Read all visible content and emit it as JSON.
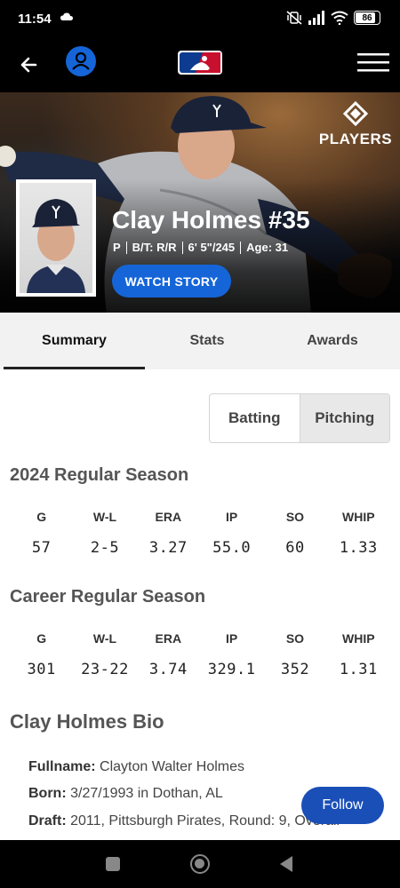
{
  "status_bar": {
    "time": "11:54",
    "battery": "86",
    "battery_level": 0.86
  },
  "hero": {
    "brand": "PLAYERS",
    "player_name": "Clay Holmes #35",
    "meta": [
      "P",
      "B/T: R/R",
      "6' 5\"/245",
      "Age: 31"
    ],
    "watch_label": "WATCH STORY"
  },
  "tabs": [
    "Summary",
    "Stats",
    "Awards"
  ],
  "toggle": {
    "batting": "Batting",
    "pitching": "Pitching"
  },
  "season": {
    "title": "2024 Regular Season",
    "headers": [
      "G",
      "W-L",
      "ERA",
      "IP",
      "SO",
      "WHIP"
    ],
    "values": [
      "57",
      "2-5",
      "3.27",
      "55.0",
      "60",
      "1.33"
    ]
  },
  "career": {
    "title": "Career Regular Season",
    "headers": [
      "G",
      "W-L",
      "ERA",
      "IP",
      "SO",
      "WHIP"
    ],
    "values": [
      "301",
      "23-22",
      "3.74",
      "329.1",
      "352",
      "1.31"
    ]
  },
  "bio": {
    "title": "Clay Holmes Bio",
    "fullname_label": "Fullname:",
    "fullname": "Clayton Walter Holmes",
    "born_label": "Born:",
    "born": "3/27/1993 in Dothan, AL",
    "draft_label": "Draft:",
    "draft": "2011, Pittsburgh Pirates, Round: 9, Overall"
  },
  "follow_label": "Follow",
  "colors": {
    "accent": "#1565d8",
    "follow": "#1a4fb8"
  }
}
